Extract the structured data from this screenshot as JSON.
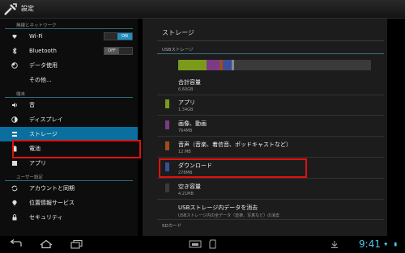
{
  "actionbar": {
    "title": "設定"
  },
  "sidebar": {
    "sections": [
      {
        "header": "無線とネットワーク"
      },
      {
        "header": "端末"
      },
      {
        "header": "ユーザー設定"
      }
    ],
    "items": [
      {
        "label": "Wi-Fi",
        "toggle": "ON"
      },
      {
        "label": "Bluetooth",
        "toggle": "OFF"
      },
      {
        "label": "データ使用"
      },
      {
        "label": "その他..."
      },
      {
        "label": "音"
      },
      {
        "label": "ディスプレイ"
      },
      {
        "label": "ストレージ"
      },
      {
        "label": "電池"
      },
      {
        "label": "アプリ"
      },
      {
        "label": "アカウントと同期"
      },
      {
        "label": "位置情報サービス"
      },
      {
        "label": "セキュリティ"
      }
    ]
  },
  "storage": {
    "title": "ストレージ",
    "subtitle": "USBストレージ",
    "usage_colors": {
      "apps": "#7b9a1a",
      "pictures": "#7b3a86",
      "audio": "#a34a1a",
      "downloads": "#3a4e9a",
      "free": "#3a3a3a"
    },
    "total": {
      "label": "合計容量",
      "value": "6.60GB"
    },
    "apps": {
      "label": "アプリ",
      "value": "1.34GB"
    },
    "pictures": {
      "label": "画像、動画",
      "value": "764MB"
    },
    "audio": {
      "label": "音声（音楽、着信音、ポッドキャストなど）",
      "value": "12.MB"
    },
    "downloads": {
      "label": "ダウンロード",
      "value": "278MB"
    },
    "free": {
      "label": "空き容量",
      "value": "4.21MB"
    },
    "erase": {
      "label": "USBストレージ内データを消去",
      "sub": "USBストレージ内の全データ（音楽、写真など）の消去"
    },
    "sd_header": "SDカード"
  },
  "statusbar": {
    "clock": "9:41"
  }
}
